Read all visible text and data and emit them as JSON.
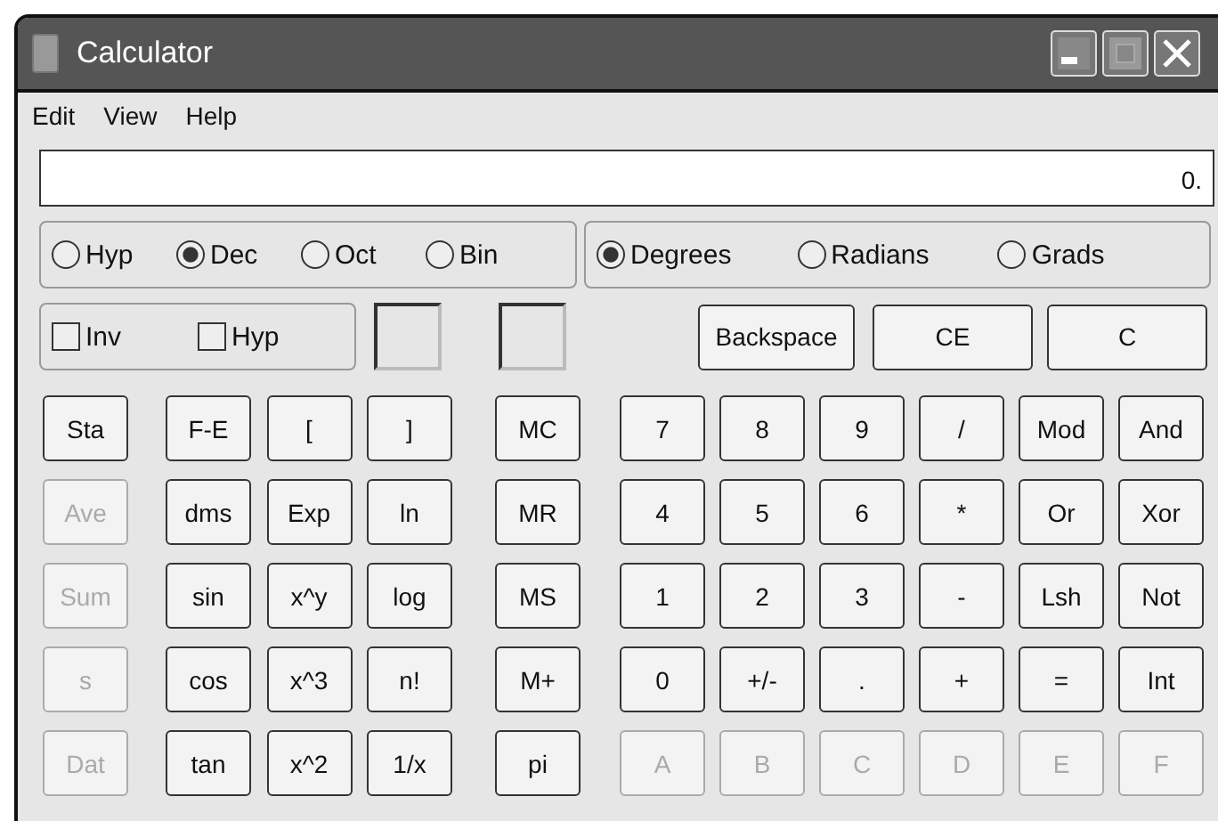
{
  "window": {
    "title": "Calculator"
  },
  "menu": [
    "Edit",
    "View",
    "Help"
  ],
  "display": {
    "value": "0."
  },
  "number_system": [
    {
      "label": "Hyp",
      "selected": false
    },
    {
      "label": "Dec",
      "selected": true
    },
    {
      "label": "Oct",
      "selected": false
    },
    {
      "label": "Bin",
      "selected": false
    }
  ],
  "angle_units": [
    {
      "label": "Degrees",
      "selected": true
    },
    {
      "label": "Radians",
      "selected": false
    },
    {
      "label": "Grads",
      "selected": false
    }
  ],
  "modifiers": [
    {
      "label": "Inv",
      "checked": false
    },
    {
      "label": "Hyp",
      "checked": false
    }
  ],
  "edit_buttons": [
    "Backspace",
    "CE",
    "C"
  ],
  "keypad": [
    {
      "buttons": [
        {
          "label": "Sta",
          "disabled": false
        },
        {
          "label": "Ave",
          "disabled": true
        },
        {
          "label": "Sum",
          "disabled": true
        },
        {
          "label": "s",
          "disabled": true
        },
        {
          "label": "Dat",
          "disabled": true
        }
      ]
    },
    {
      "buttons": [
        {
          "label": "F-E",
          "disabled": false
        },
        {
          "label": "[",
          "disabled": false
        },
        {
          "label": "]",
          "disabled": false
        },
        {
          "label": "dms",
          "disabled": false
        },
        {
          "label": "Exp",
          "disabled": false
        },
        {
          "label": "ln",
          "disabled": false
        },
        {
          "label": "sin",
          "disabled": false
        },
        {
          "label": "x^y",
          "disabled": false
        },
        {
          "label": "log",
          "disabled": false
        },
        {
          "label": "cos",
          "disabled": false
        },
        {
          "label": "x^3",
          "disabled": false
        },
        {
          "label": "n!",
          "disabled": false
        },
        {
          "label": "tan",
          "disabled": false
        },
        {
          "label": "x^2",
          "disabled": false
        },
        {
          "label": "1/x",
          "disabled": false
        }
      ]
    },
    {
      "buttons": [
        {
          "label": "MC",
          "disabled": false
        },
        {
          "label": "MR",
          "disabled": false
        },
        {
          "label": "MS",
          "disabled": false
        },
        {
          "label": "M+",
          "disabled": false
        },
        {
          "label": "pi",
          "disabled": false
        }
      ]
    },
    {
      "buttons": [
        {
          "label": "7",
          "disabled": false
        },
        {
          "label": "8",
          "disabled": false
        },
        {
          "label": "9",
          "disabled": false
        },
        {
          "label": "/",
          "disabled": false
        },
        {
          "label": "Mod",
          "disabled": false
        },
        {
          "label": "And",
          "disabled": false
        },
        {
          "label": "4",
          "disabled": false
        },
        {
          "label": "5",
          "disabled": false
        },
        {
          "label": "6",
          "disabled": false
        },
        {
          "label": "*",
          "disabled": false
        },
        {
          "label": "Or",
          "disabled": false
        },
        {
          "label": "Xor",
          "disabled": false
        },
        {
          "label": "1",
          "disabled": false
        },
        {
          "label": "2",
          "disabled": false
        },
        {
          "label": "3",
          "disabled": false
        },
        {
          "label": "-",
          "disabled": false
        },
        {
          "label": "Lsh",
          "disabled": false
        },
        {
          "label": "Not",
          "disabled": false
        },
        {
          "label": "0",
          "disabled": false
        },
        {
          "label": "+/-",
          "disabled": false
        },
        {
          "label": ".",
          "disabled": false
        },
        {
          "label": "+",
          "disabled": false
        },
        {
          "label": "=",
          "disabled": false
        },
        {
          "label": "Int",
          "disabled": false
        },
        {
          "label": "A",
          "disabled": true
        },
        {
          "label": "B",
          "disabled": true
        },
        {
          "label": "C",
          "disabled": true
        },
        {
          "label": "D",
          "disabled": true
        },
        {
          "label": "E",
          "disabled": true
        },
        {
          "label": "F",
          "disabled": true
        }
      ]
    }
  ]
}
